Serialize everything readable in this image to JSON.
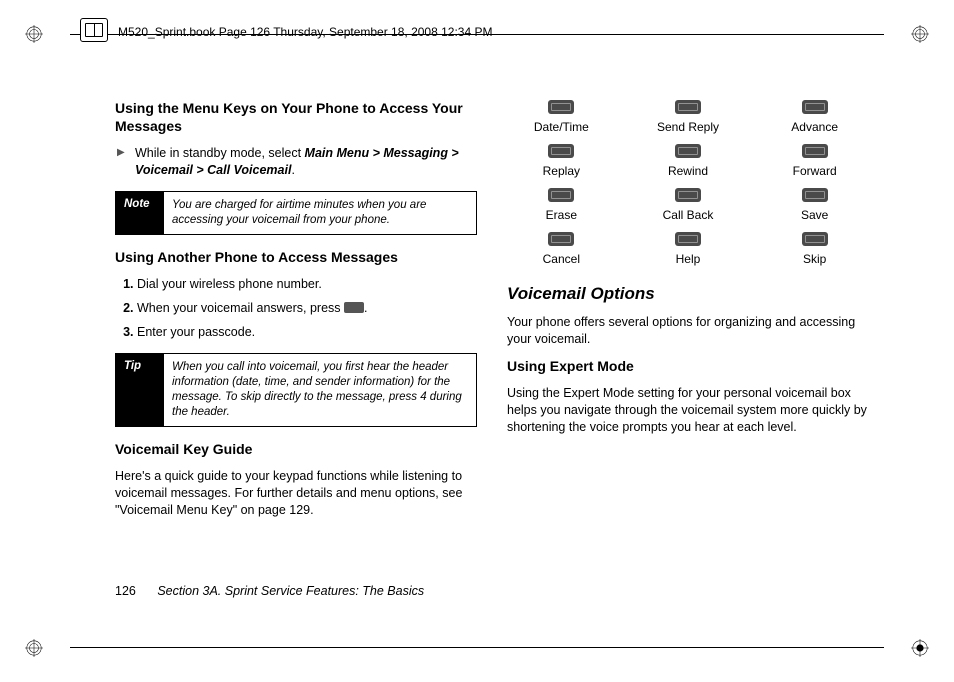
{
  "header": {
    "filename_line": "M520_Sprint.book  Page 126  Thursday, September 18, 2008  12:34 PM"
  },
  "left": {
    "h1": "Using the Menu Keys on Your Phone to Access Your Messages",
    "instr_prefix": "While in standby mode, select ",
    "instr_path": "Main Menu > Messaging > Voicemail > Call Voicemail",
    "instr_suffix": ".",
    "note_label": "Note",
    "note_text": "You are charged for airtime minutes when you are accessing your voicemail from your phone.",
    "h2": "Using Another Phone to Access Messages",
    "steps": [
      "Dial your wireless phone number.",
      "When your voicemail answers, press ",
      "Enter your passcode."
    ],
    "step2_suffix": ".",
    "tip_label": "Tip",
    "tip_text": "When you call into voicemail, you first hear the header information (date, time, and sender information) for the message. To skip directly to the message, press 4 during the header.",
    "h3": "Voicemail Key Guide",
    "guide_text": "Here's a quick guide to your keypad functions while listening to voicemail messages. For further details and menu options, see \"Voicemail Menu Key\" on page 129."
  },
  "right": {
    "keys": [
      "Date/Time",
      "Send Reply",
      "Advance",
      "Replay",
      "Rewind",
      "Forward",
      "Erase",
      "Call Back",
      "Save",
      "Cancel",
      "Help",
      "Skip"
    ],
    "section": "Voicemail Options",
    "intro": "Your phone offers several options for organizing and accessing your voicemail.",
    "sub": "Using Expert Mode",
    "sub_text": "Using the Expert Mode setting for your personal voicemail box helps you navigate through the voicemail system more quickly by shortening the voice prompts you hear at each level."
  },
  "footer": {
    "page": "126",
    "section": "Section 3A. Sprint Service Features: The Basics"
  }
}
